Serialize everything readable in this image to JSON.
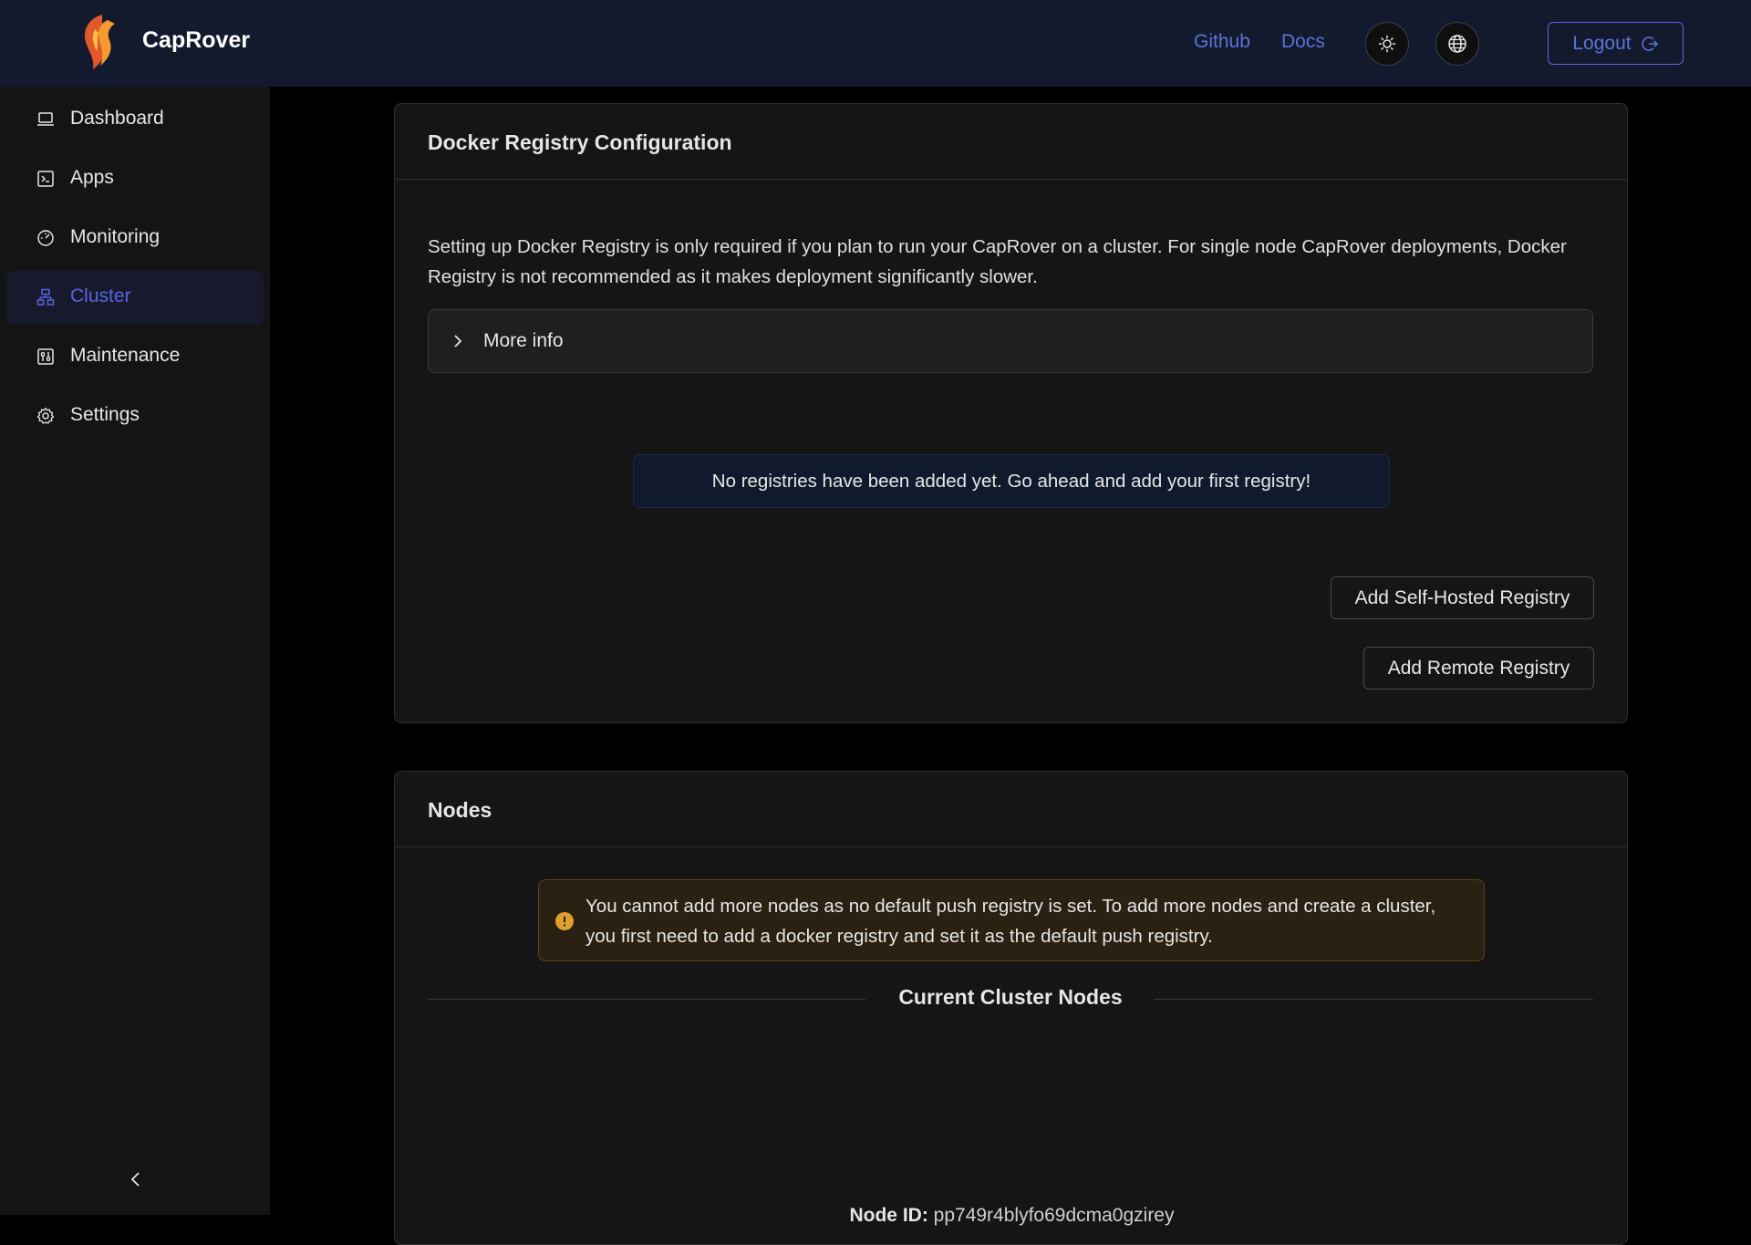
{
  "header": {
    "app_name": "CapRover",
    "links": {
      "github": "Github",
      "docs": "Docs"
    },
    "logout_label": "Logout"
  },
  "sidebar": {
    "items": [
      {
        "label": "Dashboard",
        "icon": "laptop-icon"
      },
      {
        "label": "Apps",
        "icon": "code-icon"
      },
      {
        "label": "Monitoring",
        "icon": "dashboard-gauge-icon"
      },
      {
        "label": "Cluster",
        "icon": "cluster-icon",
        "active": true
      },
      {
        "label": "Maintenance",
        "icon": "control-icon"
      },
      {
        "label": "Settings",
        "icon": "gear-icon"
      }
    ]
  },
  "registry_card": {
    "title": "Docker Registry Configuration",
    "description": "Setting up Docker Registry is only required if you plan to run your CapRover on a cluster. For single node CapRover deployments, Docker Registry is not recommended as it makes deployment significantly slower.",
    "more_info_label": "More info",
    "empty_message": "No registries have been added yet. Go ahead and add your first registry!",
    "add_self_hosted_label": "Add Self-Hosted Registry",
    "add_remote_label": "Add Remote Registry"
  },
  "nodes_card": {
    "title": "Nodes",
    "warning": "You cannot add more nodes as no default push registry is set. To add more nodes and create a cluster, you first need to add a docker registry and set it as the default push registry.",
    "current_nodes_heading": "Current Cluster Nodes",
    "node_id_label": "Node ID:",
    "node_id_value": "pp749r4blyfo69dcma0gzirey"
  },
  "colors": {
    "accent": "#5a63e0",
    "header_bg": "#141a2e",
    "warning": "#e0a030"
  }
}
